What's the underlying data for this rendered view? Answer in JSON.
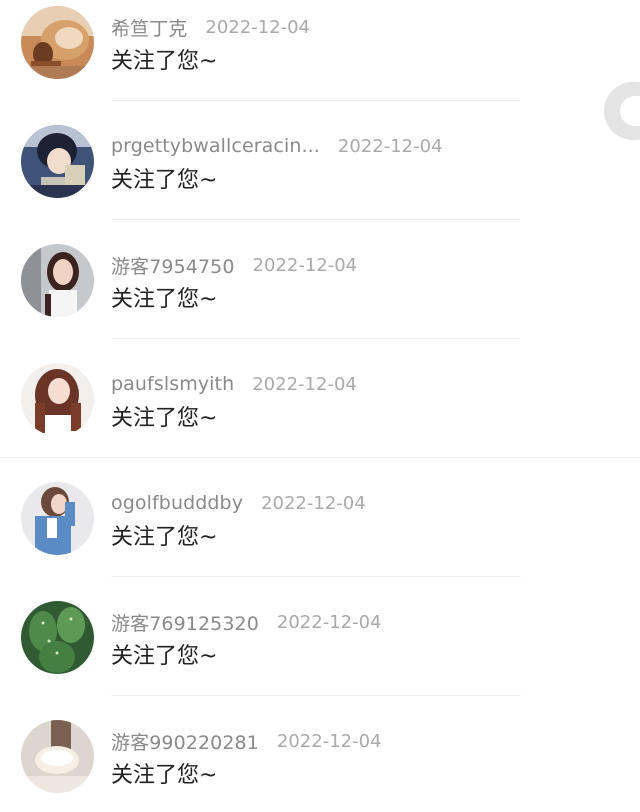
{
  "notifications": [
    {
      "username": "希笪丁克",
      "date": "2022-12-04",
      "message": "关注了您~",
      "avatar_icon": "avatar-hermit-crab"
    },
    {
      "username": "prgettybwallceracin...",
      "date": "2022-12-04",
      "message": "关注了您~",
      "avatar_icon": "avatar-anime-boy"
    },
    {
      "username": "游客7954750",
      "date": "2022-12-04",
      "message": "关注了您~",
      "avatar_icon": "avatar-woman-photo"
    },
    {
      "username": "paufslsmyith",
      "date": "2022-12-04",
      "message": "关注了您~",
      "avatar_icon": "avatar-woman-long-hair"
    },
    {
      "username": "ogolfbudddby",
      "date": "2022-12-04",
      "message": "关注了您~",
      "avatar_icon": "avatar-woman-denim"
    },
    {
      "username": "游客769125320",
      "date": "2022-12-04",
      "message": "关注了您~",
      "avatar_icon": "avatar-cactus"
    },
    {
      "username": "游客990220281",
      "date": "2022-12-04",
      "message": "关注了您~",
      "avatar_icon": "avatar-hand-shell"
    }
  ],
  "colors": {
    "username": "#8a8a8a",
    "date": "#aaaaaa",
    "message": "#222222",
    "background": "#ffffff"
  }
}
